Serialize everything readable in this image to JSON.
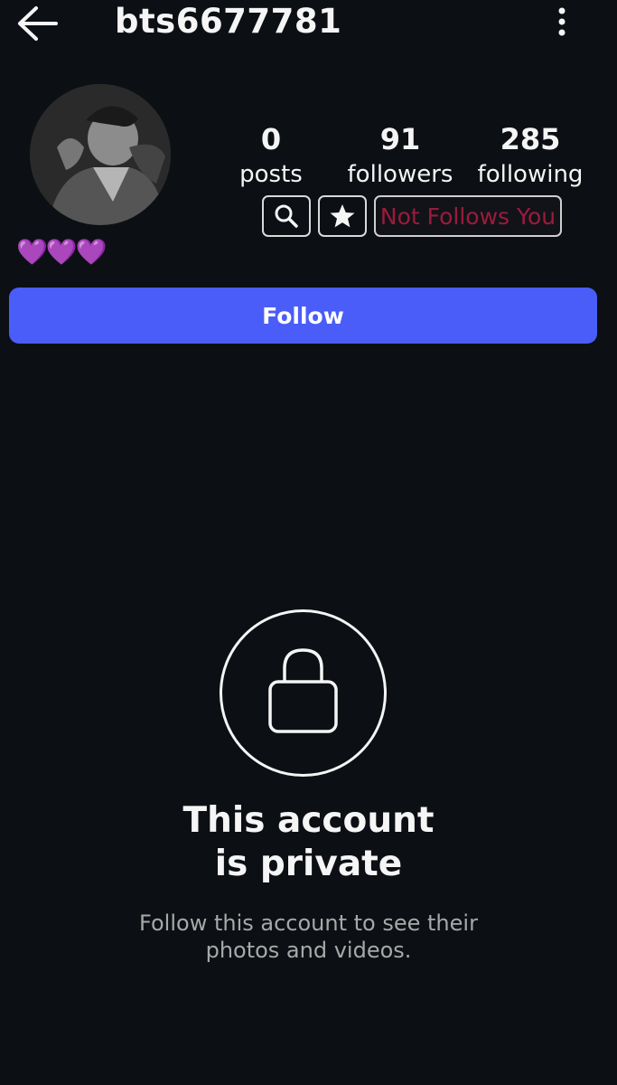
{
  "header": {
    "username": "bts6677781"
  },
  "profile": {
    "bio": "💜💜💜"
  },
  "stats": {
    "posts": {
      "count": "0",
      "label": "posts"
    },
    "followers": {
      "count": "91",
      "label": "followers"
    },
    "following": {
      "count": "285",
      "label": "following"
    }
  },
  "chips": {
    "relation_label": "Not Follows You"
  },
  "actions": {
    "follow_label": "Follow"
  },
  "private": {
    "title_line1": "This account",
    "title_line2": "is private",
    "subtitle_line1": "Follow this account to see their",
    "subtitle_line2": "photos and videos."
  },
  "colors": {
    "background": "#0c1014",
    "follow_button": "#4a5df9",
    "relation_text": "#9b1b3c",
    "bio_hearts": "#a855f7"
  },
  "icons": {
    "back": "arrow-left-icon",
    "more": "more-vertical-icon",
    "search": "search-icon",
    "star": "star-icon",
    "lock": "lock-icon"
  }
}
